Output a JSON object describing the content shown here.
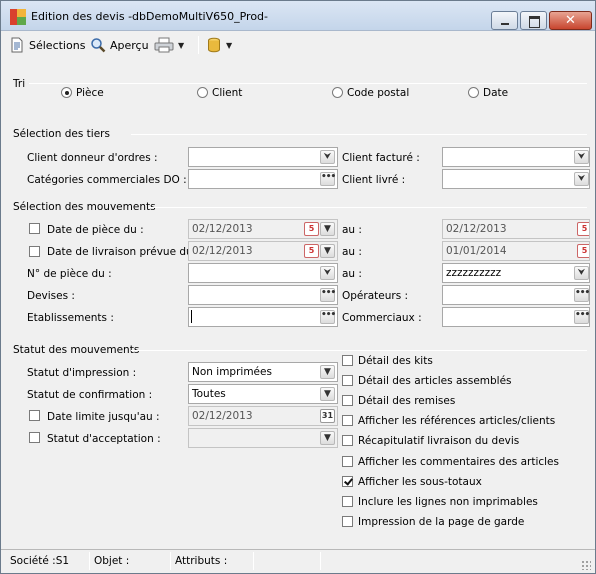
{
  "window": {
    "title": "Edition des devis -dbDemoMultiV650_Prod-",
    "close_glyph": "✕"
  },
  "toolbar": {
    "selections_label": "Sélections",
    "apercu_label": "Aperçu",
    "print_icon": "printer-icon",
    "db_icon": "database-icon"
  },
  "tri": {
    "title": "Tri",
    "options": [
      {
        "label": "Pièce",
        "selected": true
      },
      {
        "label": "Client",
        "selected": false
      },
      {
        "label": "Code postal",
        "selected": false
      },
      {
        "label": "Date",
        "selected": false
      }
    ]
  },
  "tiers": {
    "title": "Sélection des tiers",
    "client_donneur_label": "Client donneur d'ordres :",
    "client_donneur_value": "",
    "categories_label": "Catégories commerciales DO :",
    "categories_value": "",
    "client_facture_label": "Client facturé :",
    "client_facture_value": "",
    "client_livre_label": "Client livré :",
    "client_livre_value": ""
  },
  "mouvements": {
    "title": "Sélection des mouvements",
    "date_piece_label": "Date de pièce du :",
    "date_piece_from": "02/12/2013",
    "date_piece_to": "02/12/2013",
    "date_livraison_label": "Date de livraison prévue du :",
    "date_livraison_from": "02/12/2013",
    "date_livraison_to": "01/01/2014",
    "au_label": "au :",
    "num_piece_label": "N° de pièce du :",
    "num_piece_from": "",
    "num_piece_to": "zzzzzzzzzz",
    "devises_label": "Devises :",
    "devises_value": "",
    "operateurs_label": "Opérateurs :",
    "operateurs_value": "",
    "etablissements_label": "Etablissements :",
    "etablissements_value": "",
    "commerciaux_label": "Commerciaux :",
    "commerciaux_value": ""
  },
  "statut": {
    "title": "Statut des mouvements",
    "impression_label": "Statut d'impression :",
    "impression_value": "Non imprimées",
    "confirmation_label": "Statut de confirmation :",
    "confirmation_value": "Toutes",
    "date_limite_label": "Date limite jusqu'au :",
    "date_limite_value": "02/12/2013",
    "calendar_glyph": "31",
    "acceptation_label": "Statut d'acceptation :",
    "acceptation_value": ""
  },
  "options": [
    {
      "label": "Détail des kits",
      "checked": false
    },
    {
      "label": "Détail des articles assemblés",
      "checked": false
    },
    {
      "label": "Détail des remises",
      "checked": false
    },
    {
      "label": "Afficher les références articles/clients",
      "checked": false
    },
    {
      "label": "Récapitulatif livraison du devis",
      "checked": false
    },
    {
      "label": "Afficher les commentaires des articles",
      "checked": false
    },
    {
      "label": "Afficher les sous-totaux",
      "checked": true
    },
    {
      "label": "Inclure les lignes non imprimables",
      "checked": false
    },
    {
      "label": "Impression de la page de garde",
      "checked": false
    }
  ],
  "statusbar": {
    "societe": "Société :S1",
    "objet": "Objet :",
    "attributs": "Attributs :"
  },
  "glyphs": {
    "dropdown": "▼",
    "double_down": "⮟",
    "ellipsis": "•••",
    "cal_small": "5"
  }
}
